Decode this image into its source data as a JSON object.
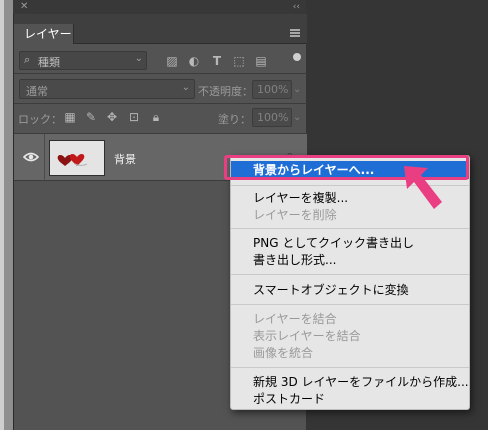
{
  "panel": {
    "tab_label": "レイヤー",
    "filter": {
      "kind_label": "種類"
    },
    "blend": {
      "mode": "通常",
      "opacity_label": "不透明度：",
      "opacity_value": "100%"
    },
    "lock": {
      "label": "ロック：",
      "fill_label": "塗り：",
      "fill_value": "100%"
    },
    "layer": {
      "name": "背景"
    }
  },
  "context_menu": {
    "highlighted": "背景からレイヤーへ...",
    "groups": [
      [
        "レイヤーを複製...",
        "レイヤーを削除"
      ],
      [
        "PNG としてクイック書き出し",
        "書き出し形式..."
      ],
      [
        "スマートオブジェクトに変換"
      ],
      [
        "レイヤーを結合",
        "表示レイヤーを結合",
        "画像を統合"
      ],
      [
        "新規 3D レイヤーをファイルから作成...",
        "ポストカード"
      ]
    ],
    "disabled": [
      "レイヤーを削除",
      "レイヤーを結合",
      "表示レイヤーを結合",
      "画像を統合"
    ]
  },
  "colors": {
    "highlight": "#1e6ed6",
    "annotation": "#ea3e83"
  }
}
